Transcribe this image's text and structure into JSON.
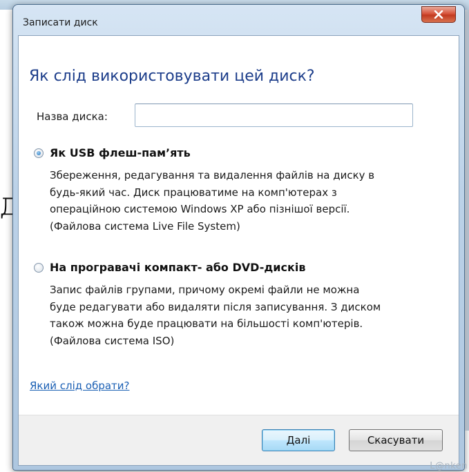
{
  "window": {
    "title": "Записати диск",
    "close_icon": "close-x-icon"
  },
  "background": {
    "fragment_text": "Д"
  },
  "dialog": {
    "heading": "Як слід використовувати цей диск?",
    "disc_name": {
      "label": "Назва диска:",
      "value": ""
    },
    "options": [
      {
        "title": "Як USB флеш-пам’ять",
        "selected": true,
        "lines": [
          "Збереження, редагування та видалення файлів на диску в",
          "будь-який час. Диск працюватиме на комп'ютерах з",
          "операційною системою Windows XP або пізнішої версії.",
          "(Файлова система Live File System)"
        ]
      },
      {
        "title": "На програвачі компакт- або DVD-дисків",
        "selected": false,
        "lines": [
          "Запис файлів групами, причому окремі файли не можна",
          "буде редагувати або видаляти після записування. З диском",
          "також можна буде працювати на більшості комп'ютерів.",
          "(Файлова система ISO)"
        ]
      }
    ],
    "help_link": "Який слід обрати?"
  },
  "buttons": {
    "next_label": "Далі",
    "cancel_label": "Скасувати"
  },
  "watermark": "L@nken",
  "colors": {
    "heading": "#1c3d8a",
    "link": "#1a5fb4",
    "close_button": "#c23a20"
  }
}
